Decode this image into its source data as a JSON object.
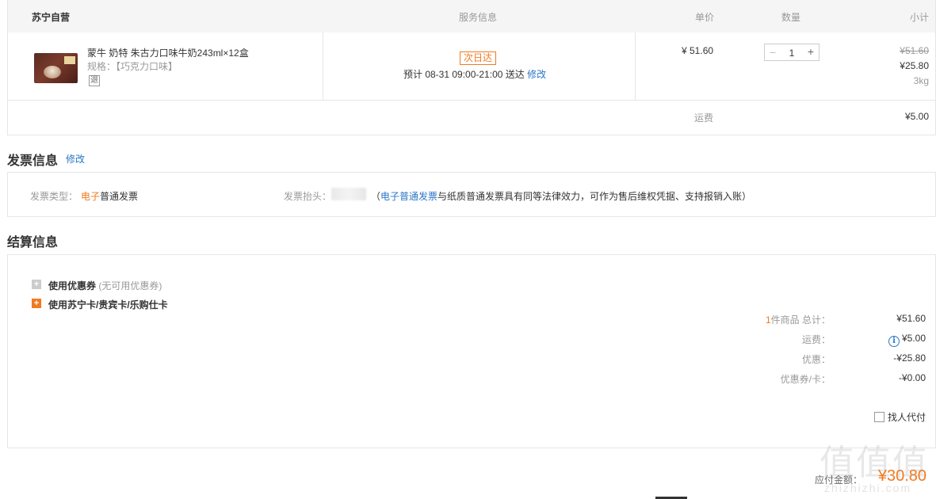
{
  "order_header": {
    "store": "苏宁自营",
    "service": "服务信息",
    "unit_price": "单价",
    "quantity": "数量",
    "subtotal": "小计"
  },
  "product": {
    "name": "蒙牛 奶特 朱古力口味牛奶243ml×12盒",
    "spec": "规格：【巧克力口味】",
    "return_badge": "退",
    "next_day_badge": "次日达",
    "delivery_text": "预计 08-31 09:00-21:00 送达",
    "delivery_edit": "修改",
    "price": "¥ 51.60",
    "quantity_value": "1",
    "minus": "−",
    "plus": "+",
    "subtotal_original": "¥51.60",
    "subtotal_now": "¥25.80",
    "weight": "3kg"
  },
  "shipping": {
    "label": "运费",
    "value": "¥5.00"
  },
  "invoice": {
    "title": "发票信息",
    "edit": "修改",
    "type_label": "发票类型：",
    "type_highlight": "电子",
    "type_rest": "普通发票",
    "header_label": "发票抬头：",
    "note_open": "（",
    "note_link": "电子普通发票",
    "note_rest": "与纸质普通发票具有同等法律效力，可作为售后维权凭据、支持报销入账）"
  },
  "settlement": {
    "title": "结算信息",
    "coupon_label": "使用优惠券",
    "coupon_note": "(无可用优惠券)",
    "card_label": "使用苏宁卡/贵宾卡/乐购仕卡",
    "items_count": "1",
    "items_label": "件商品 总计：",
    "items_total": "¥51.60",
    "freight_label": "运费：",
    "freight_value": "¥5.00",
    "discount_label": "优惠：",
    "discount_value": "-¥25.80",
    "coupon_card_label": "优惠券/卡：",
    "coupon_card_value": "-¥0.00",
    "proxy_pay": "找人代付",
    "payable_label": "应付金额：",
    "payable_value": "¥30.80"
  },
  "watermark": {
    "chars": "值值值",
    "url": "zhizhizhi.com"
  },
  "colors": {
    "accent_orange": "#f07a20",
    "link_blue": "#2a76c7"
  }
}
